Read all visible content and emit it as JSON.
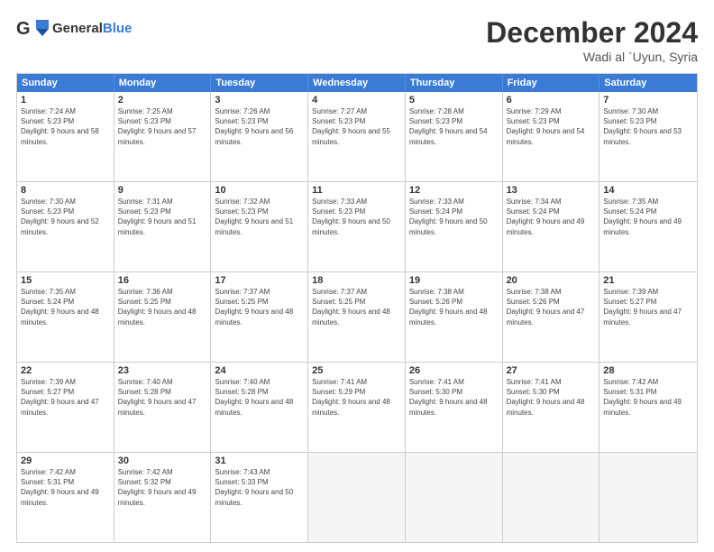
{
  "header": {
    "logo_general": "General",
    "logo_blue": "Blue",
    "month_title": "December 2024",
    "location": "Wadi al `Uyun, Syria"
  },
  "weekdays": [
    "Sunday",
    "Monday",
    "Tuesday",
    "Wednesday",
    "Thursday",
    "Friday",
    "Saturday"
  ],
  "rows": [
    [
      {
        "day": "1",
        "sunrise": "Sunrise: 7:24 AM",
        "sunset": "Sunset: 5:23 PM",
        "daylight": "Daylight: 9 hours and 58 minutes."
      },
      {
        "day": "2",
        "sunrise": "Sunrise: 7:25 AM",
        "sunset": "Sunset: 5:23 PM",
        "daylight": "Daylight: 9 hours and 57 minutes."
      },
      {
        "day": "3",
        "sunrise": "Sunrise: 7:26 AM",
        "sunset": "Sunset: 5:23 PM",
        "daylight": "Daylight: 9 hours and 56 minutes."
      },
      {
        "day": "4",
        "sunrise": "Sunrise: 7:27 AM",
        "sunset": "Sunset: 5:23 PM",
        "daylight": "Daylight: 9 hours and 55 minutes."
      },
      {
        "day": "5",
        "sunrise": "Sunrise: 7:28 AM",
        "sunset": "Sunset: 5:23 PM",
        "daylight": "Daylight: 9 hours and 54 minutes."
      },
      {
        "day": "6",
        "sunrise": "Sunrise: 7:29 AM",
        "sunset": "Sunset: 5:23 PM",
        "daylight": "Daylight: 9 hours and 54 minutes."
      },
      {
        "day": "7",
        "sunrise": "Sunrise: 7:30 AM",
        "sunset": "Sunset: 5:23 PM",
        "daylight": "Daylight: 9 hours and 53 minutes."
      }
    ],
    [
      {
        "day": "8",
        "sunrise": "Sunrise: 7:30 AM",
        "sunset": "Sunset: 5:23 PM",
        "daylight": "Daylight: 9 hours and 52 minutes."
      },
      {
        "day": "9",
        "sunrise": "Sunrise: 7:31 AM",
        "sunset": "Sunset: 5:23 PM",
        "daylight": "Daylight: 9 hours and 51 minutes."
      },
      {
        "day": "10",
        "sunrise": "Sunrise: 7:32 AM",
        "sunset": "Sunset: 5:23 PM",
        "daylight": "Daylight: 9 hours and 51 minutes."
      },
      {
        "day": "11",
        "sunrise": "Sunrise: 7:33 AM",
        "sunset": "Sunset: 5:23 PM",
        "daylight": "Daylight: 9 hours and 50 minutes."
      },
      {
        "day": "12",
        "sunrise": "Sunrise: 7:33 AM",
        "sunset": "Sunset: 5:24 PM",
        "daylight": "Daylight: 9 hours and 50 minutes."
      },
      {
        "day": "13",
        "sunrise": "Sunrise: 7:34 AM",
        "sunset": "Sunset: 5:24 PM",
        "daylight": "Daylight: 9 hours and 49 minutes."
      },
      {
        "day": "14",
        "sunrise": "Sunrise: 7:35 AM",
        "sunset": "Sunset: 5:24 PM",
        "daylight": "Daylight: 9 hours and 49 minutes."
      }
    ],
    [
      {
        "day": "15",
        "sunrise": "Sunrise: 7:35 AM",
        "sunset": "Sunset: 5:24 PM",
        "daylight": "Daylight: 9 hours and 48 minutes."
      },
      {
        "day": "16",
        "sunrise": "Sunrise: 7:36 AM",
        "sunset": "Sunset: 5:25 PM",
        "daylight": "Daylight: 9 hours and 48 minutes."
      },
      {
        "day": "17",
        "sunrise": "Sunrise: 7:37 AM",
        "sunset": "Sunset: 5:25 PM",
        "daylight": "Daylight: 9 hours and 48 minutes."
      },
      {
        "day": "18",
        "sunrise": "Sunrise: 7:37 AM",
        "sunset": "Sunset: 5:25 PM",
        "daylight": "Daylight: 9 hours and 48 minutes."
      },
      {
        "day": "19",
        "sunrise": "Sunrise: 7:38 AM",
        "sunset": "Sunset: 5:26 PM",
        "daylight": "Daylight: 9 hours and 48 minutes."
      },
      {
        "day": "20",
        "sunrise": "Sunrise: 7:38 AM",
        "sunset": "Sunset: 5:26 PM",
        "daylight": "Daylight: 9 hours and 47 minutes."
      },
      {
        "day": "21",
        "sunrise": "Sunrise: 7:39 AM",
        "sunset": "Sunset: 5:27 PM",
        "daylight": "Daylight: 9 hours and 47 minutes."
      }
    ],
    [
      {
        "day": "22",
        "sunrise": "Sunrise: 7:39 AM",
        "sunset": "Sunset: 5:27 PM",
        "daylight": "Daylight: 9 hours and 47 minutes."
      },
      {
        "day": "23",
        "sunrise": "Sunrise: 7:40 AM",
        "sunset": "Sunset: 5:28 PM",
        "daylight": "Daylight: 9 hours and 47 minutes."
      },
      {
        "day": "24",
        "sunrise": "Sunrise: 7:40 AM",
        "sunset": "Sunset: 5:28 PM",
        "daylight": "Daylight: 9 hours and 48 minutes."
      },
      {
        "day": "25",
        "sunrise": "Sunrise: 7:41 AM",
        "sunset": "Sunset: 5:29 PM",
        "daylight": "Daylight: 9 hours and 48 minutes."
      },
      {
        "day": "26",
        "sunrise": "Sunrise: 7:41 AM",
        "sunset": "Sunset: 5:30 PM",
        "daylight": "Daylight: 9 hours and 48 minutes."
      },
      {
        "day": "27",
        "sunrise": "Sunrise: 7:41 AM",
        "sunset": "Sunset: 5:30 PM",
        "daylight": "Daylight: 9 hours and 48 minutes."
      },
      {
        "day": "28",
        "sunrise": "Sunrise: 7:42 AM",
        "sunset": "Sunset: 5:31 PM",
        "daylight": "Daylight: 9 hours and 49 minutes."
      }
    ],
    [
      {
        "day": "29",
        "sunrise": "Sunrise: 7:42 AM",
        "sunset": "Sunset: 5:31 PM",
        "daylight": "Daylight: 9 hours and 49 minutes."
      },
      {
        "day": "30",
        "sunrise": "Sunrise: 7:42 AM",
        "sunset": "Sunset: 5:32 PM",
        "daylight": "Daylight: 9 hours and 49 minutes."
      },
      {
        "day": "31",
        "sunrise": "Sunrise: 7:43 AM",
        "sunset": "Sunset: 5:33 PM",
        "daylight": "Daylight: 9 hours and 50 minutes."
      },
      {
        "day": "",
        "sunrise": "",
        "sunset": "",
        "daylight": ""
      },
      {
        "day": "",
        "sunrise": "",
        "sunset": "",
        "daylight": ""
      },
      {
        "day": "",
        "sunrise": "",
        "sunset": "",
        "daylight": ""
      },
      {
        "day": "",
        "sunrise": "",
        "sunset": "",
        "daylight": ""
      }
    ]
  ]
}
